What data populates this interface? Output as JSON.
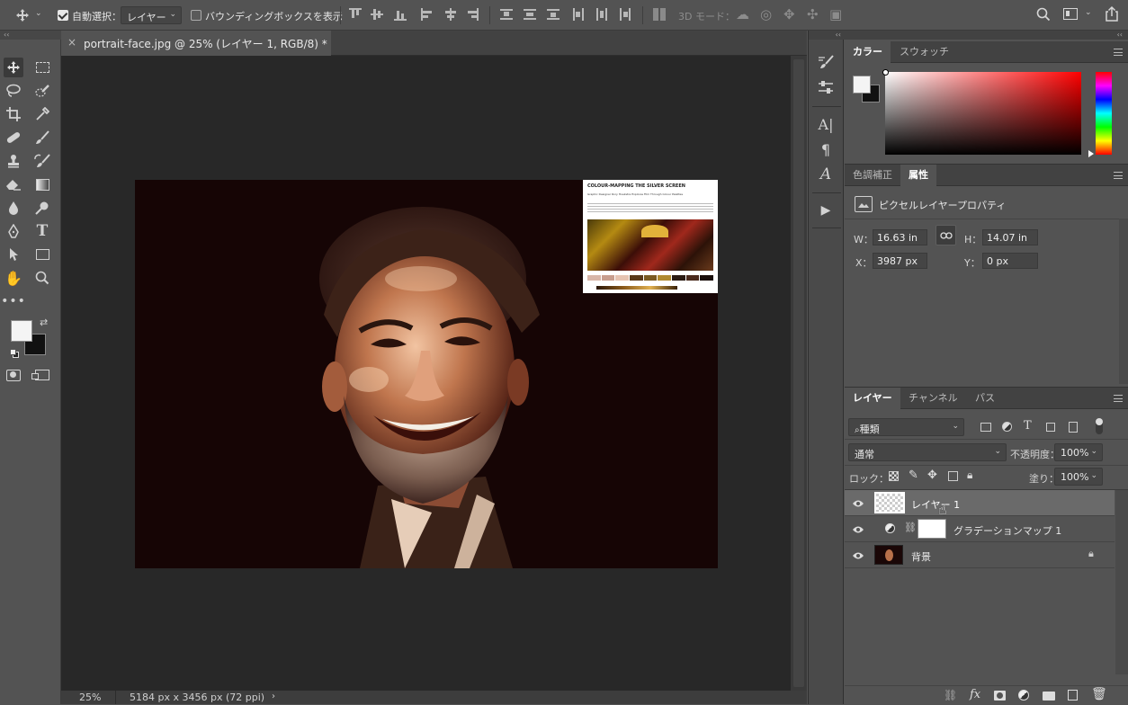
{
  "optionsbar": {
    "auto_select_label": "自動選択：",
    "auto_select_value": "レイヤー",
    "bounding_box_label": "バウンディングボックスを表示",
    "mode_3d_label": "3D モード："
  },
  "document": {
    "tab_title": "portrait-face.jpg @ 25% (レイヤー 1, RGB/8) *",
    "zoom": "25%",
    "dimensions": "5184 px x 3456 px (72 ppi)",
    "overlay": {
      "title": "COLOUR-MAPPING THE SILVER SCREEN",
      "subtitle": "Graphic Designer Rory Hoekstra Explores Film Through Colour Palettes"
    }
  },
  "color_panel": {
    "tabs": [
      "カラー",
      "スウォッチ"
    ],
    "active_tab": 0
  },
  "properties_panel": {
    "tabs": [
      "色調補正",
      "属性"
    ],
    "active_tab": 1,
    "heading": "ピクセルレイヤープロパティ",
    "w_label": "W：",
    "w_value": "16.63 in",
    "h_label": "H：",
    "h_value": "14.07 in",
    "x_label": "X：",
    "x_value": "3987 px",
    "y_label": "Y：",
    "y_value": "0 px"
  },
  "layers_panel": {
    "tabs": [
      "レイヤー",
      "チャンネル",
      "パス"
    ],
    "active_tab": 0,
    "filter_value": "種類",
    "blend_mode": "通常",
    "opacity_label": "不透明度：",
    "opacity_value": "100%",
    "lock_label": "ロック：",
    "fill_label": "塗り：",
    "fill_value": "100%",
    "layers": [
      {
        "name": "レイヤー 1",
        "selected": true
      },
      {
        "name": "グラデーションマップ 1",
        "selected": false
      },
      {
        "name": "背景",
        "selected": false,
        "locked": true
      }
    ]
  },
  "colors": {
    "foreground": "#f4f4f4",
    "background": "#111111",
    "ui_bg": "#535353"
  }
}
